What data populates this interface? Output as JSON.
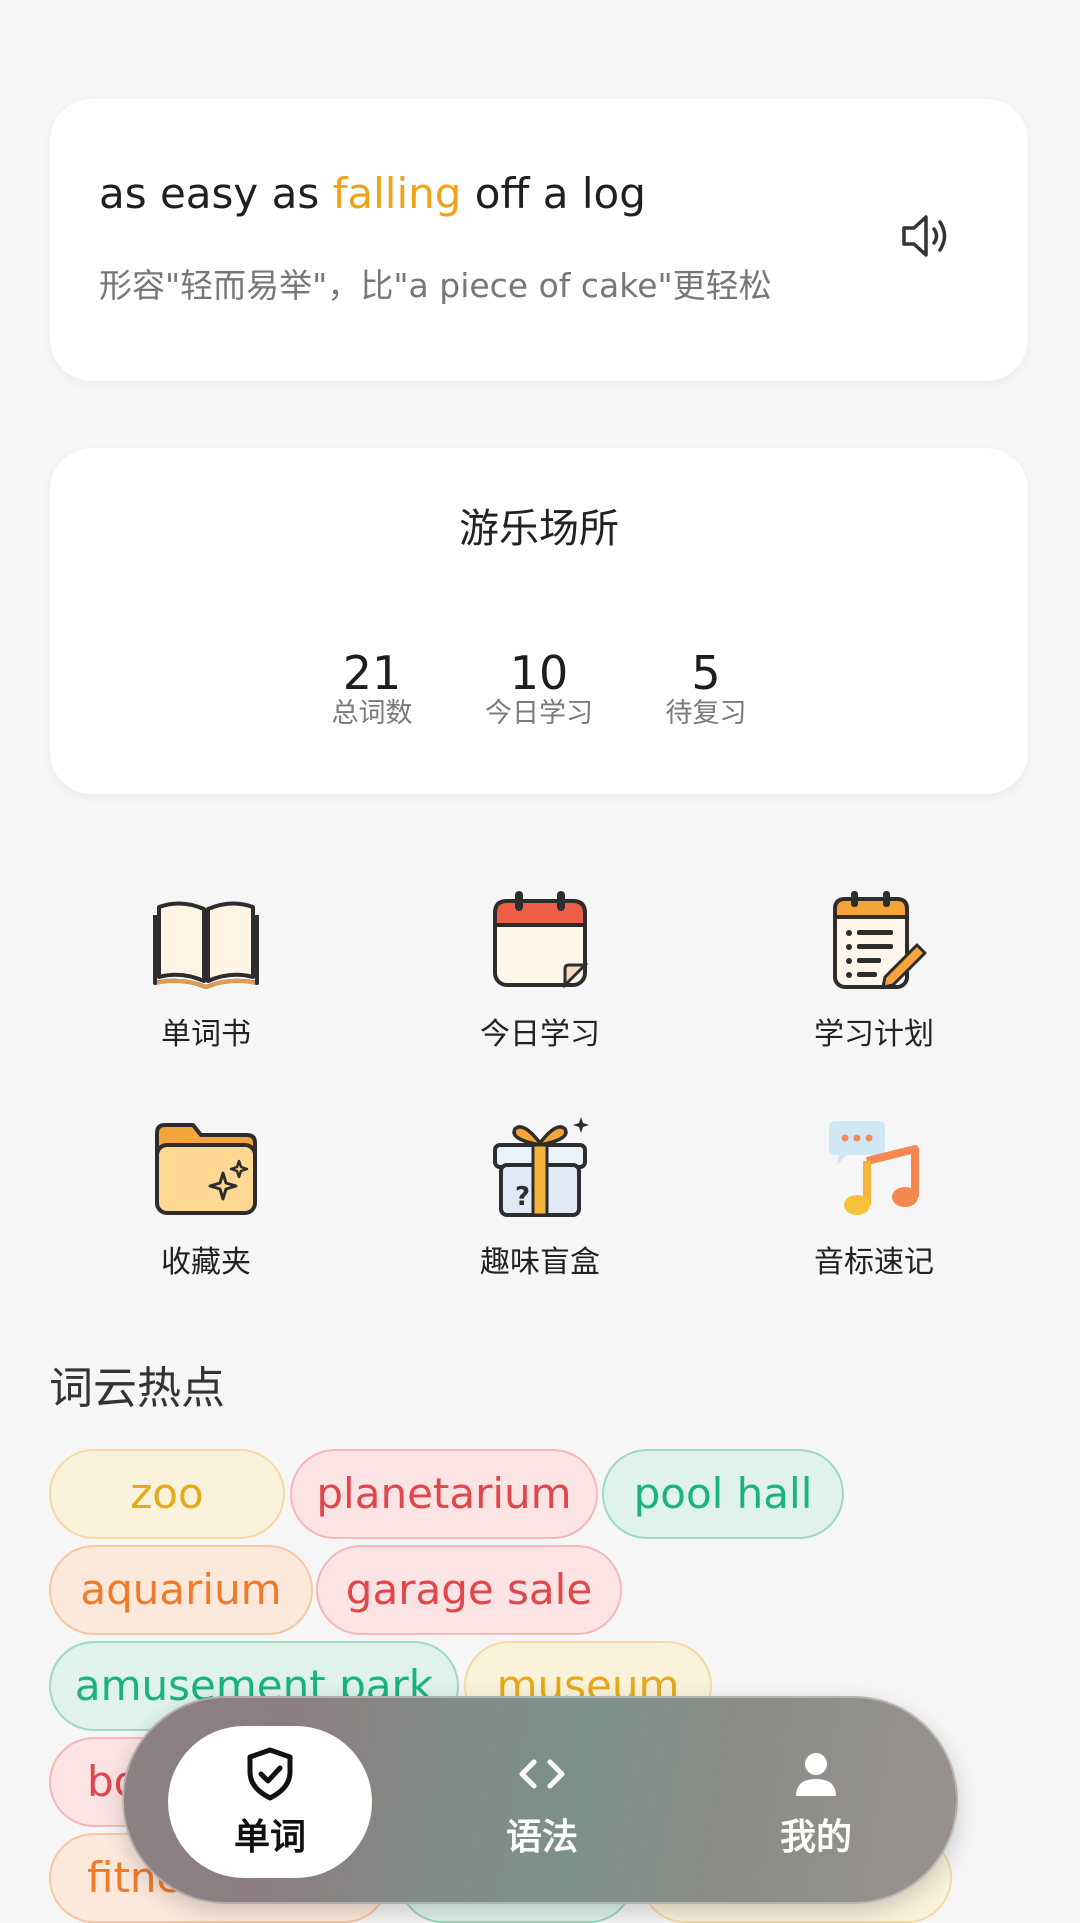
{
  "phrase": {
    "before": "as easy as ",
    "highlight": "falling",
    "after": " off a log",
    "meaning": "形容\"轻而易举\"，比\"a piece of cake\"更轻松",
    "highlight_color": "#f0a21a",
    "speaker_icon": "speaker-icon"
  },
  "category": {
    "title": "游乐场所",
    "stats": [
      {
        "value": "21",
        "label": "总词数"
      },
      {
        "value": "10",
        "label": "今日学习"
      },
      {
        "value": "5",
        "label": "待复习"
      }
    ]
  },
  "features": [
    {
      "label": "单词书",
      "icon": "book-icon"
    },
    {
      "label": "今日学习",
      "icon": "calendar-icon"
    },
    {
      "label": "学习计划",
      "icon": "plan-notepad-icon"
    },
    {
      "label": "收藏夹",
      "icon": "folder-icon"
    },
    {
      "label": "趣味盲盒",
      "icon": "gift-box-icon"
    },
    {
      "label": "音标速记",
      "icon": "music-note-icon"
    }
  ],
  "word_cloud": {
    "title": "词云热点",
    "chips": [
      {
        "text": "zoo",
        "color": "yellow"
      },
      {
        "text": "planetarium",
        "color": "red"
      },
      {
        "text": "pool hall",
        "color": "green"
      },
      {
        "text": "aquarium",
        "color": "orange"
      },
      {
        "text": "garage sale",
        "color": "red"
      },
      {
        "text": "amusement park",
        "color": "green"
      },
      {
        "text": "museum",
        "color": "yellow"
      },
      {
        "text": "bo",
        "color": "red"
      },
      {
        "text": "fitne",
        "color": "orange"
      }
    ]
  },
  "nav": {
    "items": [
      {
        "label": "单词",
        "icon": "shield-check-icon",
        "active": true
      },
      {
        "label": "语法",
        "icon": "code-brackets-icon",
        "active": false
      },
      {
        "label": "我的",
        "icon": "user-icon",
        "active": false
      }
    ]
  }
}
